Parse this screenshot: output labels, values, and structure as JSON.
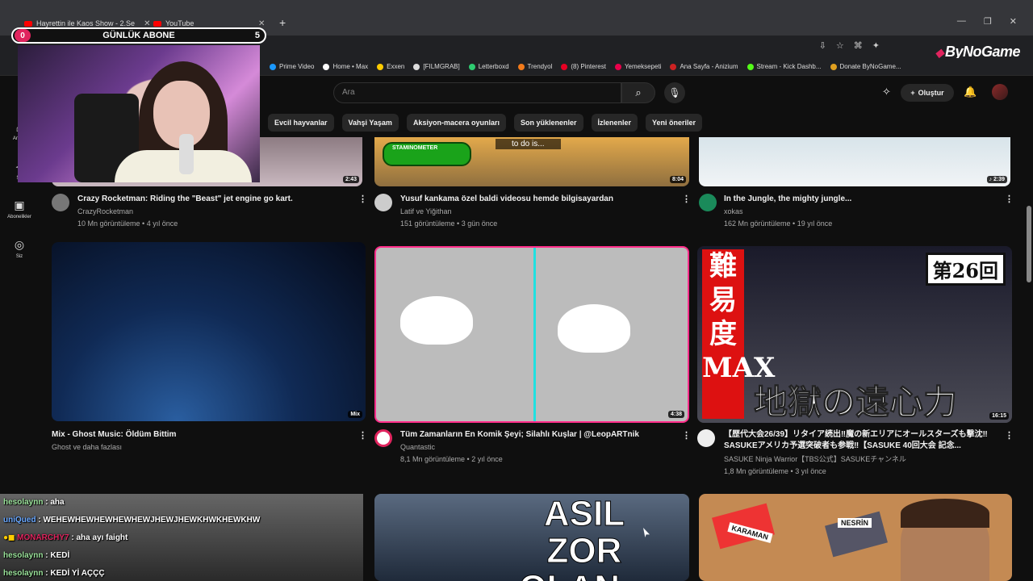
{
  "browser": {
    "tabs": [
      {
        "label": "Hayrettin ile Kaos Show - 2.Se"
      },
      {
        "label": "YouTube"
      }
    ],
    "bookmarks": [
      "Prime Video",
      "Home • Max",
      "Exxen",
      "[FILMGRAB]",
      "Letterboxd",
      "Trendyol",
      "(8) Pinterest",
      "Yemeksepeti",
      "Ana Sayfa - Anizium",
      "Stream - Kick Dashb...",
      "Donate ByNoGame..."
    ],
    "brand": "ByNoGame"
  },
  "overlay": {
    "sub_label": "GÜNLÜK ABONE",
    "sub_count_left": "0",
    "sub_count_right": "5"
  },
  "youtube": {
    "search_placeholder": "Ara",
    "create_label": "Oluştur",
    "chips": [
      "Evcil hayvanlar",
      "Vahşi Yaşam",
      "Aksiyon-macera oyunları",
      "Son yüklenenler",
      "İzlenenler",
      "Yeni öneriler"
    ],
    "sidebar": [
      {
        "label": "Ana S"
      },
      {
        "label": "Sh"
      },
      {
        "label": "Abonelikler"
      },
      {
        "label": "Siz"
      }
    ],
    "videos": [
      {
        "title": "Crazy Rocketman: Riding the \"Beast\" jet engine go kart.",
        "channel": "CrazyRocketman",
        "meta": "10 Mn görüntüleme • 4 yıl önce",
        "duration": "2:43"
      },
      {
        "title": "Yusuf kankama özel baldi videosu hemde bilgisayardan",
        "channel": "Latif ve Yiğithan",
        "meta": "151 görüntüleme • 3 gün önce",
        "duration": "8:04",
        "thumb_text": "STAMINOMETER",
        "caption": "to do is..."
      },
      {
        "title": "In the Jungle, the mighty jungle...",
        "channel": "xokas",
        "meta": "162 Mn görüntüleme • 19 yıl önce",
        "duration": "♪ 2:39"
      },
      {
        "title": "Mix - Ghost Music: Öldüm Bittim",
        "channel": "Ghost ve daha fazlası",
        "meta": "",
        "duration": "Mix"
      },
      {
        "title": "Tüm Zamanların En Komik Şeyi; Silahlı Kuşlar | @LeopARTnik",
        "channel": "Quantastic",
        "meta": "8,1 Mn görüntüleme • 2 yıl önce",
        "duration": "4:38"
      },
      {
        "title": "【歴代大会26/39】リタイア続出‼魔の新エリアにオールスターズも撃沈‼SASUKEアメリカ予選突破者も参戦‼【SASUKE 40回大会 記念...",
        "channel": "SASUKE Ninja Warrior【TBS公式】SASUKEチャンネル",
        "meta": "1,8 Mn görüntüleme • 3 yıl önce",
        "duration": "16:15",
        "side_text": "難易度MAX",
        "bottom_text": "地獄の遠心力",
        "tag": "第26回"
      },
      {
        "big_text": "ASIL ZOR OLAN..."
      },
      {
        "labels": [
          "KARAMAN",
          "NESRİN"
        ]
      }
    ]
  },
  "chat": [
    {
      "user": "hesolaynn",
      "msg": ": aha",
      "color": "#9be39b"
    },
    {
      "user": "uniQued",
      "msg": ": WEHEWHEWHEWHEWHEWJHEWJHEWKHWKHEWKHW",
      "color": "#6aa8ff"
    },
    {
      "user": "MONARCHY7",
      "msg": ": aha ayı faight",
      "color": "#e0245e"
    },
    {
      "user": "hesolaynn",
      "msg": ": KEDİ",
      "color": "#9be39b"
    },
    {
      "user": "hesolaynn",
      "msg": ": KEDİ Yİ AÇÇÇ",
      "color": "#9be39b"
    }
  ],
  "colors": {
    "accent": "#ff0000",
    "bg": "#0f0f0f",
    "chip": "#272727",
    "subbar_pink": "#e0245e"
  }
}
